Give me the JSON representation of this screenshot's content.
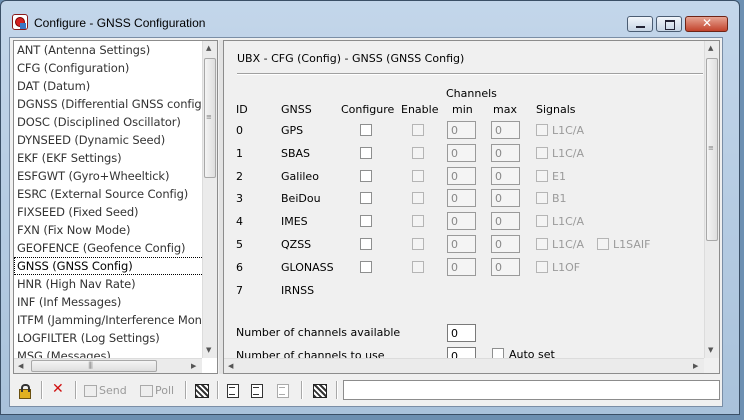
{
  "window": {
    "title": "Configure - GNSS Configuration"
  },
  "message_list": {
    "items": [
      "ANT (Antenna Settings)",
      "CFG (Configuration)",
      "DAT (Datum)",
      "DGNSS (Differential GNSS configura",
      "DOSC (Disciplined Oscillator)",
      "DYNSEED (Dynamic Seed)",
      "EKF (EKF Settings)",
      "ESFGWT (Gyro+Wheeltick)",
      "ESRC (External Source Config)",
      "FIXSEED (Fixed Seed)",
      "FXN (Fix Now Mode)",
      "GEOFENCE (Geofence Config)",
      "GNSS (GNSS Config)",
      "HNR (High Nav Rate)",
      "INF (Inf Messages)",
      "ITFM (Jamming/Interference Monit",
      "LOGFILTER (Log Settings)",
      "MSG (Messages)"
    ],
    "selected_index": 12
  },
  "panel": {
    "title": "UBX - CFG (Config) - GNSS (GNSS Config)",
    "headers": {
      "id": "ID",
      "gnss": "GNSS",
      "configure": "Configure",
      "enable": "Enable",
      "channels": "Channels",
      "min": "min",
      "max": "max",
      "signals": "Signals"
    },
    "rows": [
      {
        "id": "0",
        "gnss": "GPS",
        "min": "0",
        "max": "0",
        "signals": [
          "L1C/A"
        ]
      },
      {
        "id": "1",
        "gnss": "SBAS",
        "min": "0",
        "max": "0",
        "signals": [
          "L1C/A"
        ]
      },
      {
        "id": "2",
        "gnss": "Galileo",
        "min": "0",
        "max": "0",
        "signals": [
          "E1"
        ]
      },
      {
        "id": "3",
        "gnss": "BeiDou",
        "min": "0",
        "max": "0",
        "signals": [
          "B1"
        ]
      },
      {
        "id": "4",
        "gnss": "IMES",
        "min": "0",
        "max": "0",
        "signals": [
          "L1C/A"
        ]
      },
      {
        "id": "5",
        "gnss": "QZSS",
        "min": "0",
        "max": "0",
        "signals": [
          "L1C/A",
          "L1SAIF"
        ]
      },
      {
        "id": "6",
        "gnss": "GLONASS",
        "min": "0",
        "max": "0",
        "signals": [
          "L1OF"
        ]
      },
      {
        "id": "7",
        "gnss": "IRNSS"
      }
    ],
    "channels_available_label": "Number of channels available",
    "channels_available_value": "0",
    "channels_to_use_label": "Number of channels to use",
    "channels_to_use_value": "0",
    "auto_set_label": "Auto set"
  },
  "toolbar": {
    "send_label": "Send",
    "poll_label": "Poll"
  }
}
